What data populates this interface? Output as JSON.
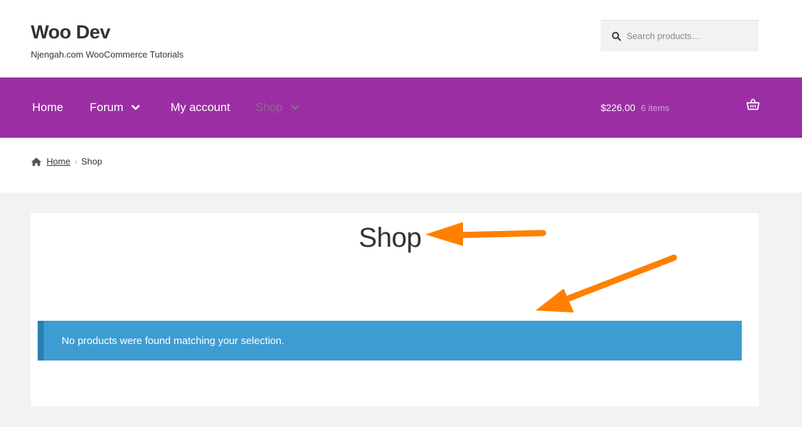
{
  "header": {
    "site_title": "Woo Dev",
    "tagline": "Njengah.com WooCommerce Tutorials",
    "search": {
      "placeholder": "Search products…",
      "icon": "search-icon"
    }
  },
  "nav": {
    "items": [
      {
        "label": "Home",
        "has_dropdown": false,
        "current": false
      },
      {
        "label": "Forum",
        "has_dropdown": true,
        "current": false
      },
      {
        "label": "My account",
        "has_dropdown": false,
        "current": false
      },
      {
        "label": "Shop",
        "has_dropdown": true,
        "current": true
      }
    ],
    "cart": {
      "amount": "$226.00",
      "count": "6 items",
      "icon": "basket-icon"
    },
    "background_color": "#9c2ea3"
  },
  "breadcrumb": {
    "home_icon": "home-icon",
    "home_label": "Home",
    "current": "Shop"
  },
  "main": {
    "title": "Shop",
    "notice": "No products were found matching your selection.",
    "notice_color": "#3d9cd2"
  },
  "annotations": {
    "arrow_color": "#ff8000"
  }
}
